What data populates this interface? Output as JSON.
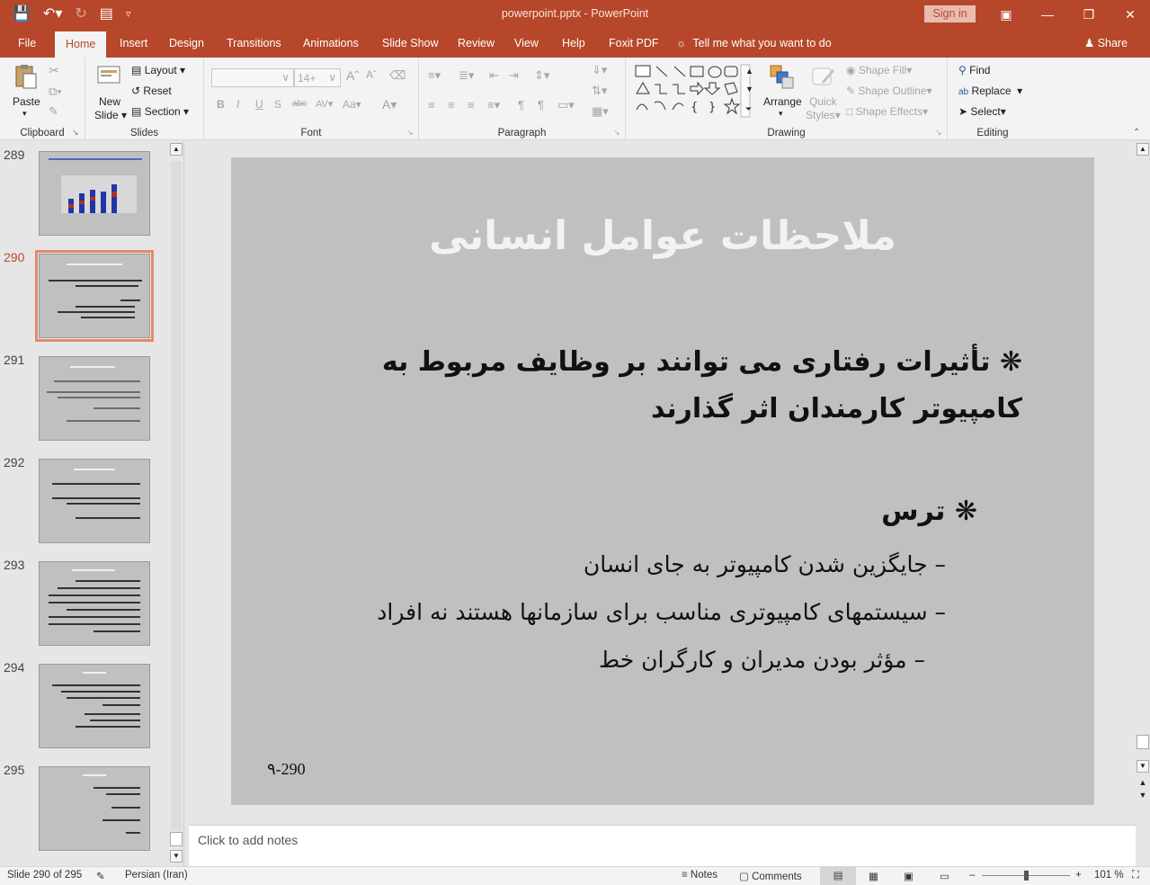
{
  "app": {
    "title": "powerpoint.pptx  -  PowerPoint",
    "sign_in": "Sign in"
  },
  "tabs": [
    "File",
    "Home",
    "Insert",
    "Design",
    "Transitions",
    "Animations",
    "Slide Show",
    "Review",
    "View",
    "Help",
    "Foxit PDF"
  ],
  "active_tab": "Home",
  "tell_me": "Tell me what you want to do",
  "share": "Share",
  "ribbon": {
    "clipboard": {
      "label": "Clipboard",
      "paste": "Paste"
    },
    "slides": {
      "label": "Slides",
      "new_slide_1": "New",
      "new_slide_2": "Slide",
      "layout": "Layout",
      "reset": "Reset",
      "section": "Section"
    },
    "font": {
      "label": "Font",
      "size": "14+"
    },
    "paragraph": {
      "label": "Paragraph"
    },
    "drawing": {
      "label": "Drawing",
      "arrange": "Arrange",
      "quick_styles_1": "Quick",
      "quick_styles_2": "Styles",
      "shape_fill": "Shape Fill",
      "shape_outline": "Shape Outline",
      "shape_effects": "Shape Effects"
    },
    "editing": {
      "label": "Editing",
      "find": "Find",
      "replace": "Replace",
      "select": "Select"
    }
  },
  "thumbnails": [
    {
      "num": "289",
      "selected": false
    },
    {
      "num": "290",
      "selected": true
    },
    {
      "num": "291",
      "selected": false
    },
    {
      "num": "292",
      "selected": false
    },
    {
      "num": "293",
      "selected": false
    },
    {
      "num": "294",
      "selected": false
    },
    {
      "num": "295",
      "selected": false
    }
  ],
  "slide": {
    "title": "ملاحظات عوامل انسانی",
    "bullet1": "❋ تأثیرات رفتاری می توانند بر وظایف مربوط به کامپیوتر کارمندان اثر گذارند",
    "bullet2": "❋ ترس",
    "sub1": "– جایگزین شدن کامپیوتر به جای انسان",
    "sub2": "– سیستمهای کامپیوتری مناسب برای سازمانها هستند نه افراد",
    "sub3": "– مؤثر بودن مدیران و کارگران خط",
    "slide_number": "۹-290"
  },
  "notes_placeholder": "Click to add notes",
  "status": {
    "slide_info": "Slide 290 of 295",
    "language": "Persian (Iran)",
    "notes": "Notes",
    "comments": "Comments",
    "zoom": "101 %"
  }
}
